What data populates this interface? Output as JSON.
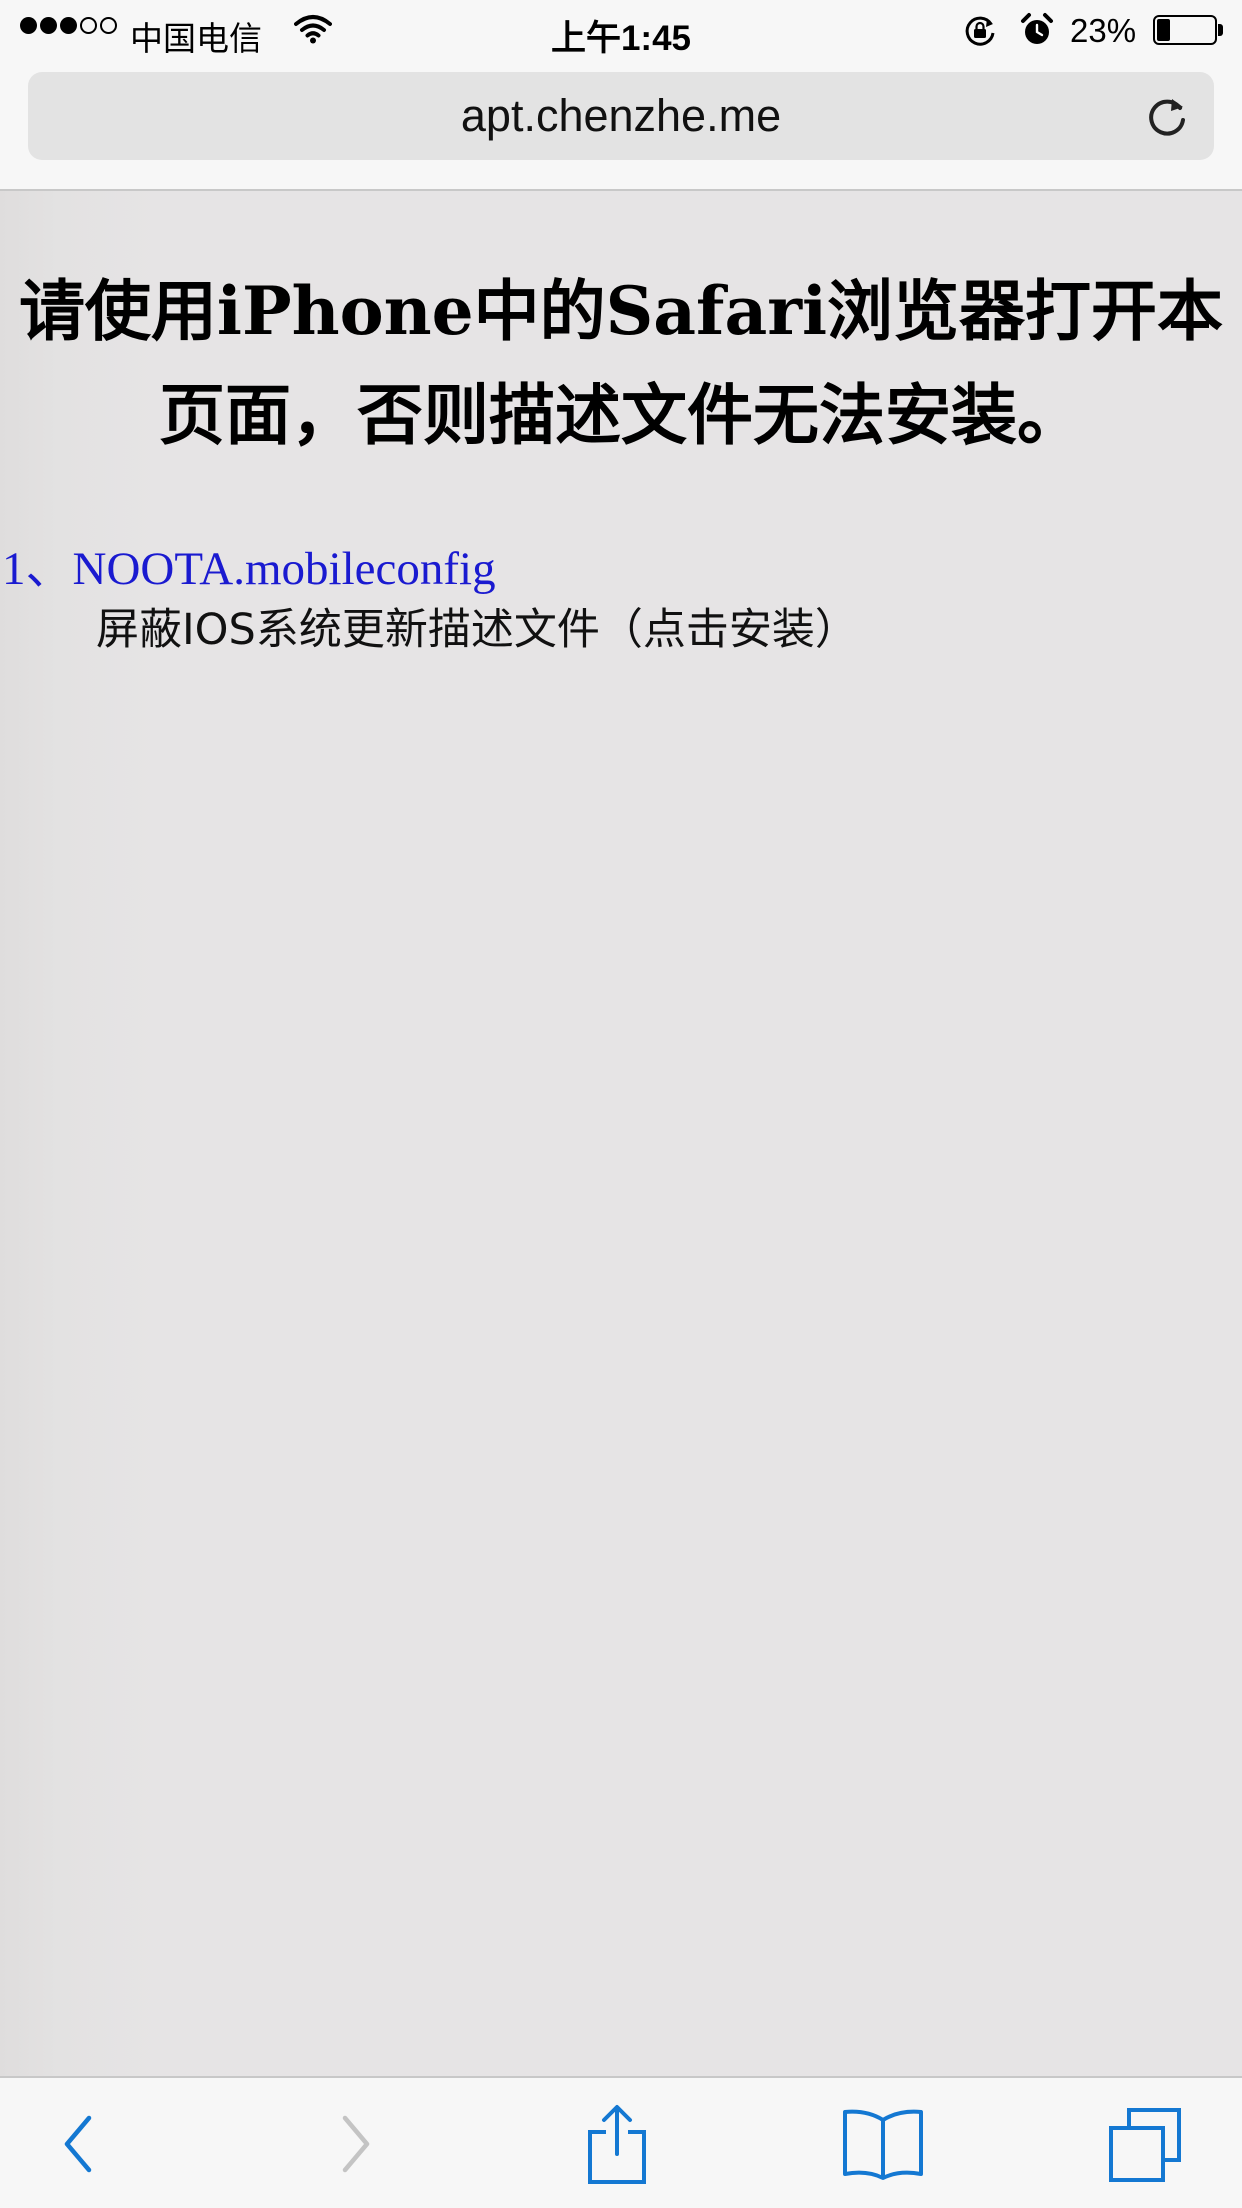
{
  "status_bar": {
    "signal_dots_filled": 3,
    "signal_dots_total": 5,
    "carrier": "中国电信",
    "time": "上午1:45",
    "battery_percent": "23%",
    "battery_level": 0.23,
    "icons": [
      "wifi-icon",
      "rotation-lock-icon",
      "alarm-icon",
      "battery-icon"
    ]
  },
  "browser": {
    "url": "apt.chenzhe.me",
    "reload_icon": "reload-icon"
  },
  "page": {
    "title": "请使用iPhone中的Safari浏览器打开本页面，否则描述文件无法安装。",
    "items": [
      {
        "link": "1、NOOTA.mobileconfig",
        "description": "屏蔽IOS系统更新描述文件（点击安装）"
      }
    ]
  },
  "toolbar": {
    "buttons": [
      "back-icon",
      "forward-icon",
      "share-icon",
      "bookmarks-icon",
      "tabs-icon"
    ]
  },
  "colors": {
    "accent": "#1478d2",
    "link": "#1a1ad0",
    "page_background": "#e6e4e5",
    "chrome_background": "#f7f7f7",
    "disabled": "#c4c4c4"
  }
}
